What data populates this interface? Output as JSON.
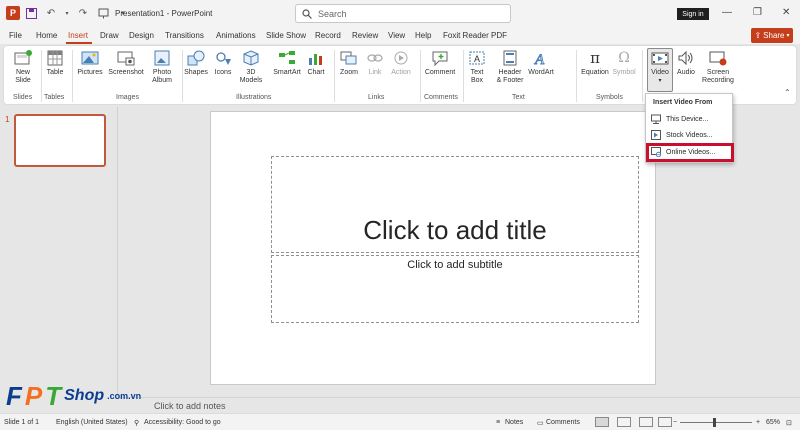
{
  "title_bar": {
    "app_title": "Presentation1  -  PowerPoint",
    "search_placeholder": "Search",
    "sign_in": "Sign in"
  },
  "tabs": [
    "File",
    "Home",
    "Insert",
    "Draw",
    "Design",
    "Transitions",
    "Animations",
    "Slide Show",
    "Record",
    "Review",
    "View",
    "Help",
    "Foxit Reader PDF"
  ],
  "active_tab": "Insert",
  "share_label": "Share",
  "ribbon": {
    "new_slide": [
      "New",
      "Slide"
    ],
    "table": "Table",
    "pictures": "Pictures",
    "screenshot": "Screenshot",
    "photo_album": [
      "Photo",
      "Album"
    ],
    "shapes": "Shapes",
    "icons": "Icons",
    "models_3d": [
      "3D",
      "Models"
    ],
    "smartart": "SmartArt",
    "chart": "Chart",
    "zoom": "Zoom",
    "link": "Link",
    "action": "Action",
    "comment": "Comment",
    "text_box": [
      "Text",
      "Box"
    ],
    "header_footer": [
      "Header",
      "& Footer"
    ],
    "wordart": "WordArt",
    "equation": "Equation",
    "symbol": "Symbol",
    "video": "Video",
    "audio": "Audio",
    "screen_recording": [
      "Screen",
      "Recording"
    ],
    "groups": {
      "slides": "Slides",
      "tables": "Tables",
      "images": "Images",
      "illustrations": "Illustrations",
      "links": "Links",
      "comments": "Comments",
      "text": "Text",
      "symbols": "Symbols"
    }
  },
  "slide_panel": {
    "slide_number": "1"
  },
  "slide": {
    "title_placeholder": "Click to add title",
    "subtitle_placeholder": "Click to add subtitle"
  },
  "notes_placeholder": "Click to add notes",
  "video_menu": {
    "heading": "Insert Video From",
    "items": [
      "This Device...",
      "Stock Videos...",
      "Online Videos..."
    ]
  },
  "status_bar": {
    "slide_info": "Slide 1 of 1",
    "language": "English (United States)",
    "accessibility": "Accessibility: Good to go",
    "notes": "Notes",
    "comments": "Comments",
    "zoom_level": "65%"
  },
  "watermark": {
    "letters": [
      "F",
      "P",
      "T"
    ],
    "shop": "Shop",
    "domain": ".com.vn"
  },
  "colors": {
    "accent": "#c43e1c",
    "highlight_box": "#c8102e",
    "fpt_blue": "#0a3d8f",
    "fpt_orange": "#f37021",
    "fpt_green": "#3aaa35"
  }
}
